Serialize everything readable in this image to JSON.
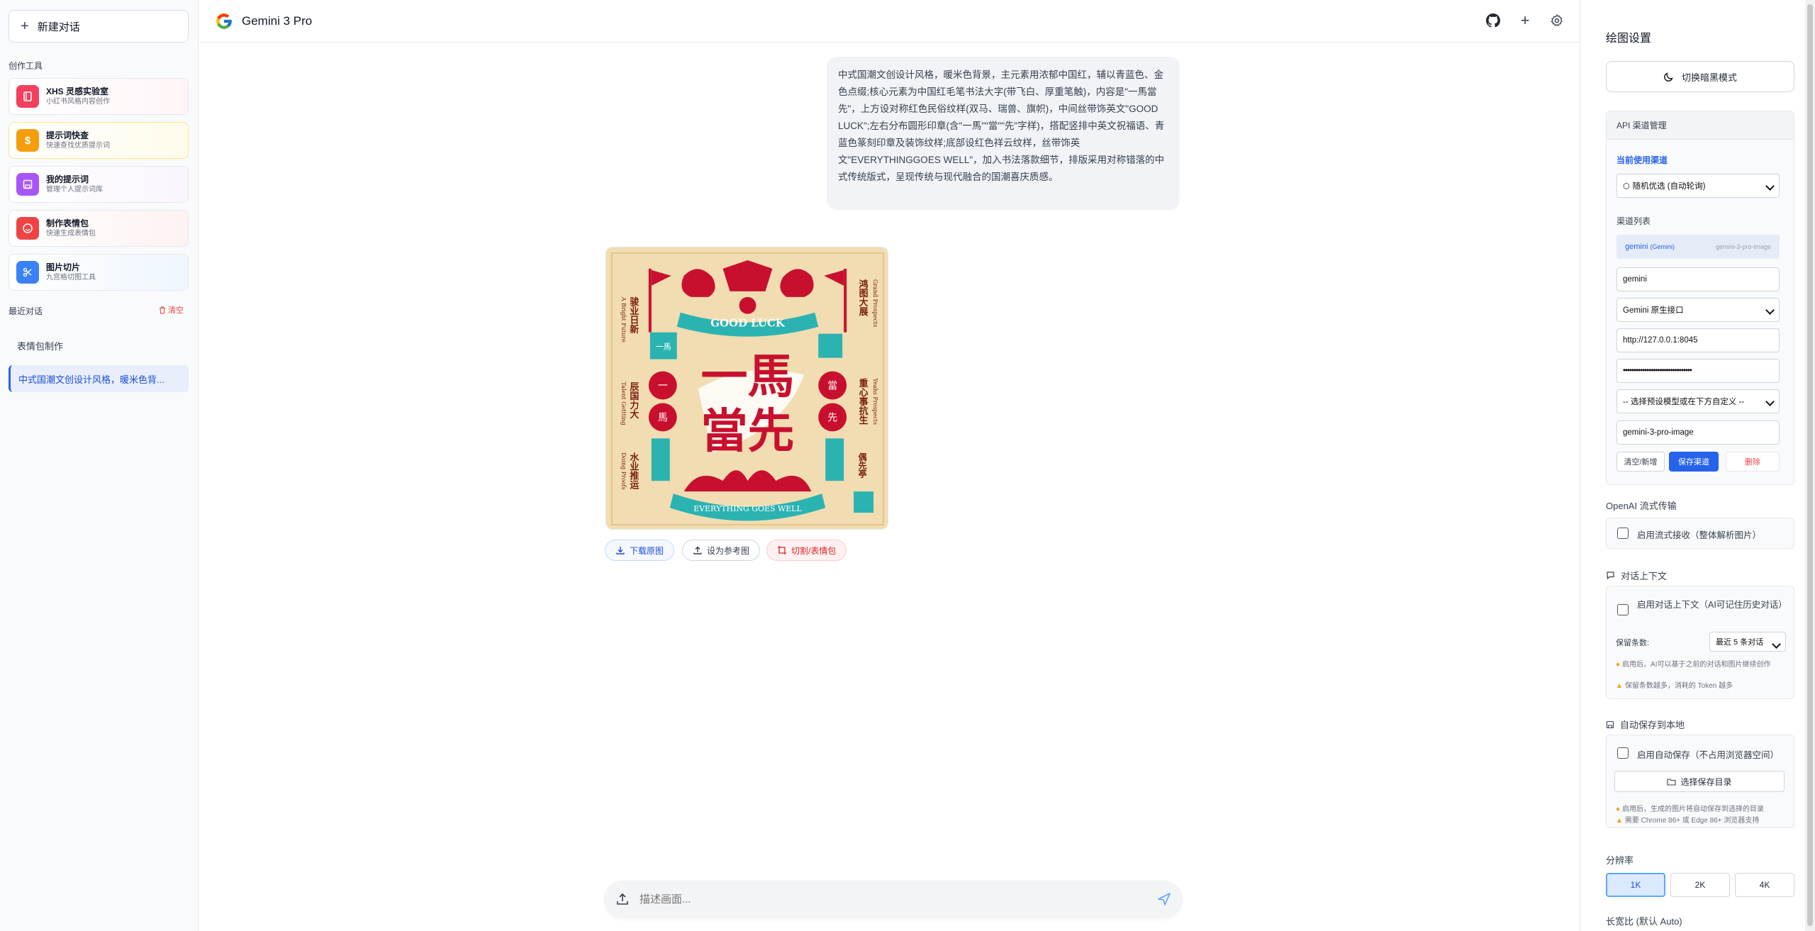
{
  "app": {
    "title": "Gemini 3 Pro"
  },
  "sidebar": {
    "new_chat": "新建对话",
    "tools_label": "创作工具",
    "tools": [
      {
        "title": "XHS 灵感实验室",
        "subtitle": "小红书风格内容创作",
        "icon": "book-icon",
        "color": "#f43f5e"
      },
      {
        "title": "提示词快查",
        "subtitle": "快速查找优质提示词",
        "icon": "dollar-icon",
        "color": "#f59e0b"
      },
      {
        "title": "我的提示词",
        "subtitle": "管理个人提示词库",
        "icon": "save-icon",
        "color": "#a855f7"
      },
      {
        "title": "制作表情包",
        "subtitle": "快速生成表情包",
        "icon": "smile-icon",
        "color": "#ef4444"
      },
      {
        "title": "图片切片",
        "subtitle": "九宫格切图工具",
        "icon": "scissors-icon",
        "color": "#3b82f6"
      }
    ],
    "recent_label": "最近对话",
    "clear_label": "清空",
    "history": [
      "表情包制作",
      "中式国潮文创设计风格，暖米色背..."
    ]
  },
  "chat": {
    "user_message": "中式国潮文创设计风格，暖米色背景，主元素用浓郁中国红，辅以青蓝色、金色点缀;核心元素为中国红毛笔书法大字(带飞白、厚重笔触)，内容是\"一馬當先\"，上方设对称红色民俗纹样(双马、瑞兽、旗帜)，中间丝带饰英文\"GOOD LUCK\";左右分布圆形印章(含\"一馬\"\"當\"\"先\"字样)，搭配竖排中英文祝福语、青蓝色篆刻印章及装饰纹样;底部设红色祥云纹样，丝带饰英文\"EVERYTHINGGOES WELL\"，加入书法落款细节，排版采用对称错落的中式传统版式，呈现传统与现代融合的国潮喜庆质感。",
    "image_text": {
      "ribbon_top": "GOOD LUCK",
      "main_line1": "一馬",
      "main_line2": "當先",
      "seal_left_top": "一馬",
      "seal_left": "一",
      "seal_left2": "馬",
      "seal_right": "當",
      "seal_right2": "先",
      "ribbon_bottom": "EVERYTHING GOES WELL",
      "left_col1": "骏业日新",
      "left_col1_en": "A Bright Future",
      "left_col2": "辰国力大",
      "left_col2_en": "Talent Gettting",
      "left_col3": "水业推运",
      "left_col3_en": "Doing Proofs",
      "right_col1": "鸿图大展",
      "right_col1_en": "Grand Prospects",
      "right_col2": "重心事抗生",
      "right_col2_en": "Yeahs Prospects",
      "signature": "偶先亭"
    },
    "actions": {
      "download": "下载原图",
      "set_reference": "设为参考图",
      "cut_sticker": "切割/表情包"
    },
    "input_placeholder": "描述画面..."
  },
  "settings": {
    "title": "绘图设置",
    "dark_mode": "切换暗黑模式",
    "api_section": "API 渠道管理",
    "current_channel_label": "当前使用渠道",
    "current_channel_value": "随机优选 (自动轮询)",
    "channel_list_label": "渠道列表",
    "channel_name": "gemini",
    "channel_type": "(Gemini)",
    "channel_model": "gemini-3-pro-image",
    "name_field": "gemini",
    "interface_field": "Gemini 原生接口",
    "url_field": "http://127.0.0.1:8045",
    "key_field": "••••••••••••••••••••••••••••••••",
    "model_select": "-- 选择预设模型或在下方自定义 --",
    "model_field": "gemini-3-pro-image",
    "btn_clear": "清空/新增",
    "btn_save": "保存渠道",
    "btn_delete": "删除",
    "openai_stream_title": "OpenAI 流式传输",
    "openai_stream_option": "启用流式接收（整体解析图片）",
    "context_title": "对话上下文",
    "context_option": "启用对话上下文（AI可记住历史对话）",
    "keep_label": "保留条数:",
    "keep_value": "最近 5 条对话",
    "context_hint1": "启用后，AI可以基于之前的对话和图片继续创作",
    "context_hint2": "保留条数越多，消耗的 Token 越多",
    "autosave_title": "自动保存到本地",
    "autosave_option": "启用自动保存（不占用浏览器空间）",
    "choose_dir": "选择保存目录",
    "autosave_hint1": "启用后，生成的图片将自动保存到选择的目录",
    "autosave_hint2": "需要 Chrome 86+ 或 Edge 86+ 浏览器支持",
    "resolution_title": "分辨率",
    "resolutions": [
      "1K",
      "2K",
      "4K"
    ],
    "aspect_title": "长宽比 (默认 Auto)"
  },
  "colors": {
    "accent": "#2563eb",
    "danger": "#ef4444",
    "poster_bg": "#f1ddb1",
    "poster_red": "#c8102e",
    "poster_teal": "#2bb3b1"
  }
}
